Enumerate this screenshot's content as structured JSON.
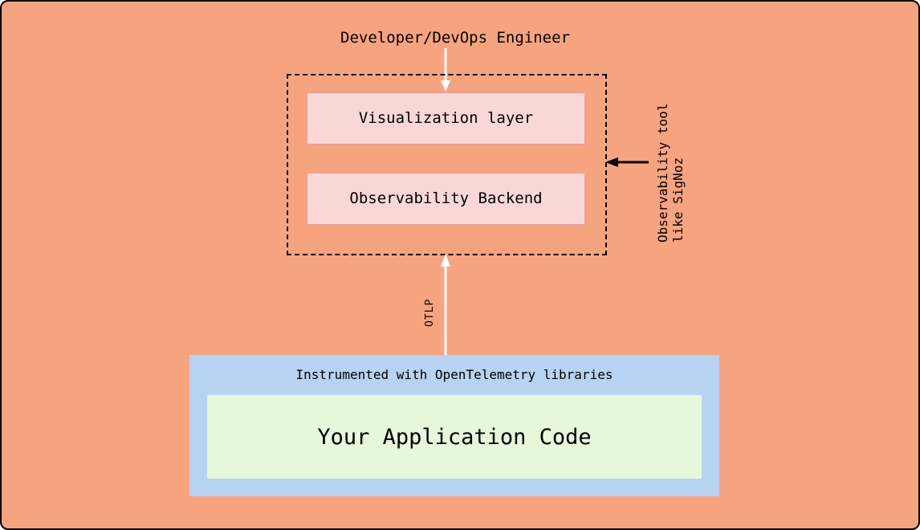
{
  "diagram": {
    "top_label": "Developer/DevOps Engineer",
    "dashed_group_side_label": "Observability tool\nlike SigNoz",
    "visualization_layer": "Visualization layer",
    "observability_backend": "Observability Backend",
    "protocol_label": "OTLP",
    "bottom_group_caption": "Instrumented with OpenTelemetry libraries",
    "app_code_label": "Your Application Code"
  },
  "colors": {
    "canvas_bg": "#f6a380",
    "layer_bg": "#fad7d7",
    "bottom_bg": "#b7d3f2",
    "app_bg": "#e7f8da"
  }
}
